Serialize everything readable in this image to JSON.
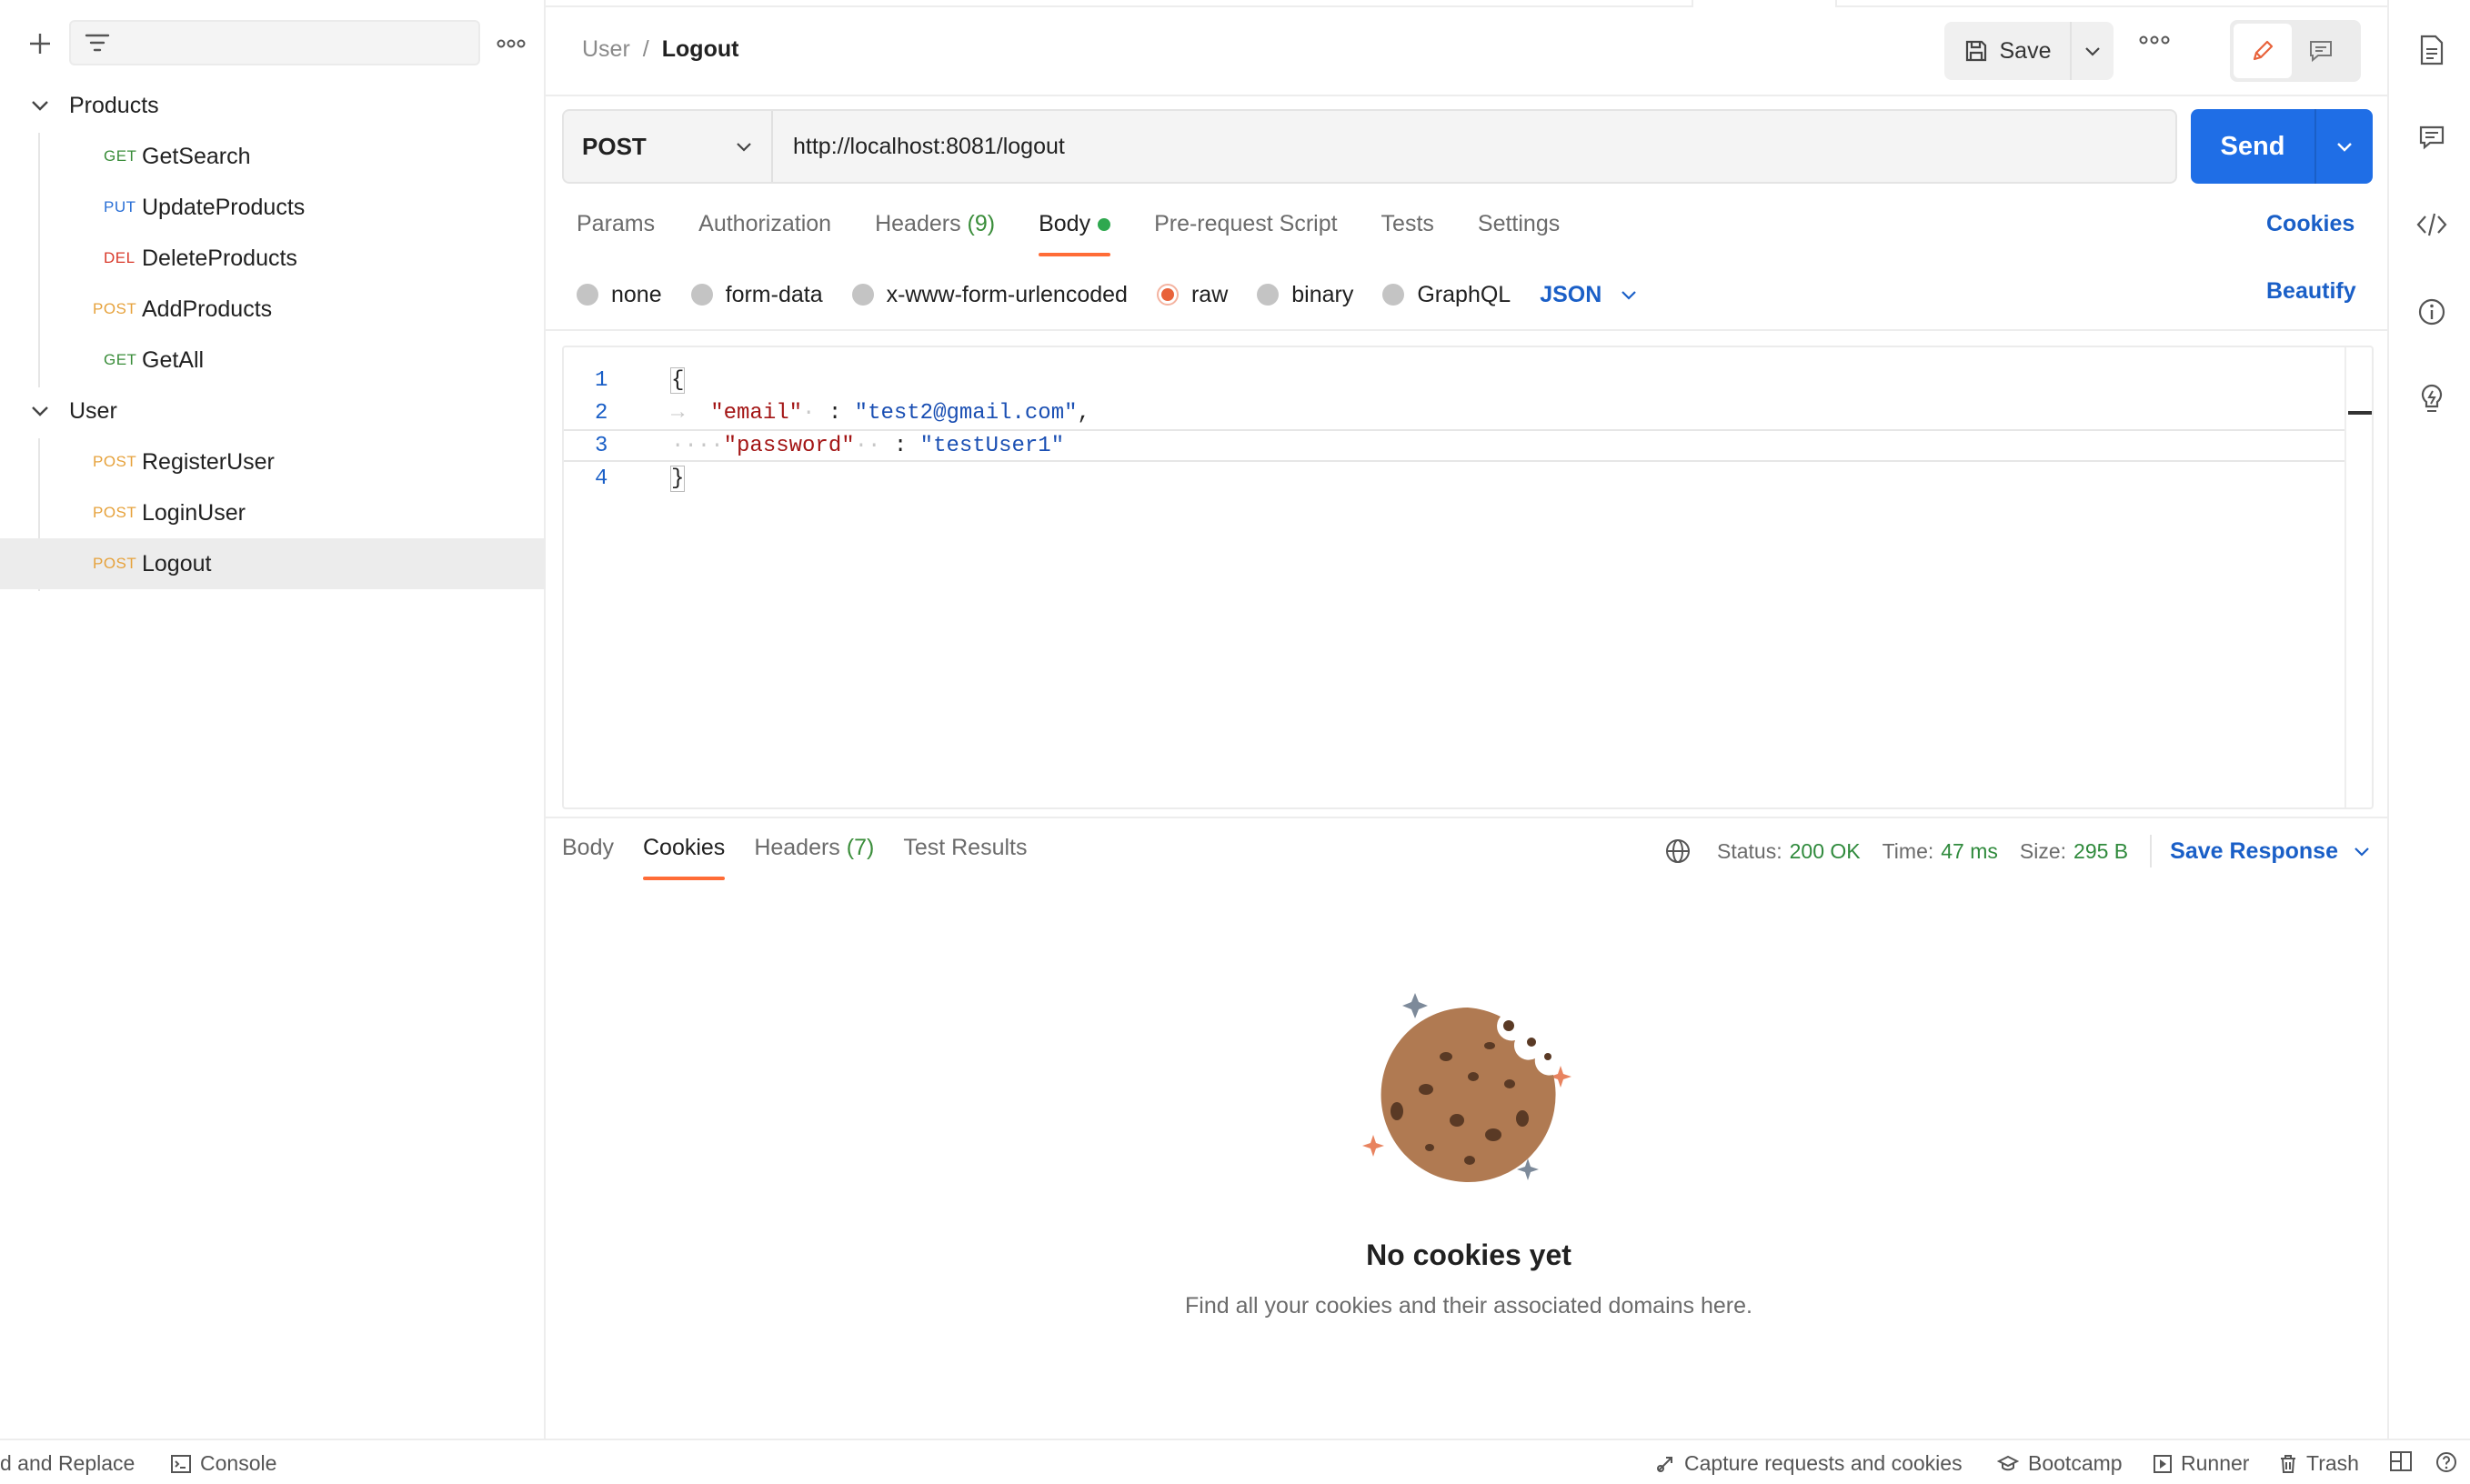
{
  "sidebar": {
    "filter_placeholder": "",
    "collections": [
      {
        "name": "Products",
        "requests": [
          {
            "method": "GET",
            "name": "GetSearch"
          },
          {
            "method": "PUT",
            "name": "UpdateProducts"
          },
          {
            "method": "DEL",
            "name": "DeleteProducts"
          },
          {
            "method": "POST",
            "name": "AddProducts"
          },
          {
            "method": "GET",
            "name": "GetAll"
          }
        ]
      },
      {
        "name": "User",
        "requests": [
          {
            "method": "POST",
            "name": "RegisterUser"
          },
          {
            "method": "POST",
            "name": "LoginUser"
          },
          {
            "method": "POST",
            "name": "Logout",
            "selected": true
          }
        ]
      }
    ],
    "method_colors": {
      "GET": "#3a8d3a",
      "PUT": "#2a6fd6",
      "DEL": "#d93a2b",
      "POST": "#e6a23c"
    }
  },
  "header": {
    "breadcrumb_parent": "User",
    "breadcrumb_sep": "/",
    "breadcrumb_current": "Logout",
    "save_label": "Save"
  },
  "request": {
    "method": "POST",
    "url": "http://localhost:8081/logout",
    "send_label": "Send",
    "tabs": [
      {
        "label": "Params"
      },
      {
        "label": "Authorization"
      },
      {
        "label": "Headers",
        "count": "(9)"
      },
      {
        "label": "Body",
        "active": true,
        "dot": true
      },
      {
        "label": "Pre-request Script"
      },
      {
        "label": "Tests"
      },
      {
        "label": "Settings"
      }
    ],
    "cookies_link": "Cookies",
    "body_types": [
      "none",
      "form-data",
      "x-www-form-urlencoded",
      "raw",
      "binary",
      "GraphQL"
    ],
    "body_type_selected": "raw",
    "format": "JSON",
    "beautify_label": "Beautify",
    "code_lines": [
      {
        "n": "1",
        "text": "{"
      },
      {
        "n": "2",
        "key": "\"email\"",
        "value": "\"test2@gmail.com\"",
        "trail": ","
      },
      {
        "n": "3",
        "key": "\"password\"",
        "value": "\"testUser1\"",
        "trail": ""
      },
      {
        "n": "4",
        "text": "}"
      }
    ]
  },
  "response": {
    "tabs": [
      {
        "label": "Body"
      },
      {
        "label": "Cookies",
        "active": true
      },
      {
        "label": "Headers",
        "count": "(7)"
      },
      {
        "label": "Test Results"
      }
    ],
    "status_label": "Status:",
    "status_value": "200 OK",
    "time_label": "Time:",
    "time_value": "47 ms",
    "size_label": "Size:",
    "size_value": "295 B",
    "save_response_label": "Save Response",
    "empty_title": "No cookies yet",
    "empty_desc": "Find all your cookies and their associated domains here."
  },
  "statusbar": {
    "find_replace": "d and Replace",
    "console": "Console",
    "capture": "Capture requests and cookies",
    "bootcamp": "Bootcamp",
    "runner": "Runner",
    "trash": "Trash"
  },
  "colors": {
    "accent": "#ff6c37",
    "primary": "#1f6ee6",
    "link": "#1a5fc7",
    "success": "#2f8a3c"
  }
}
